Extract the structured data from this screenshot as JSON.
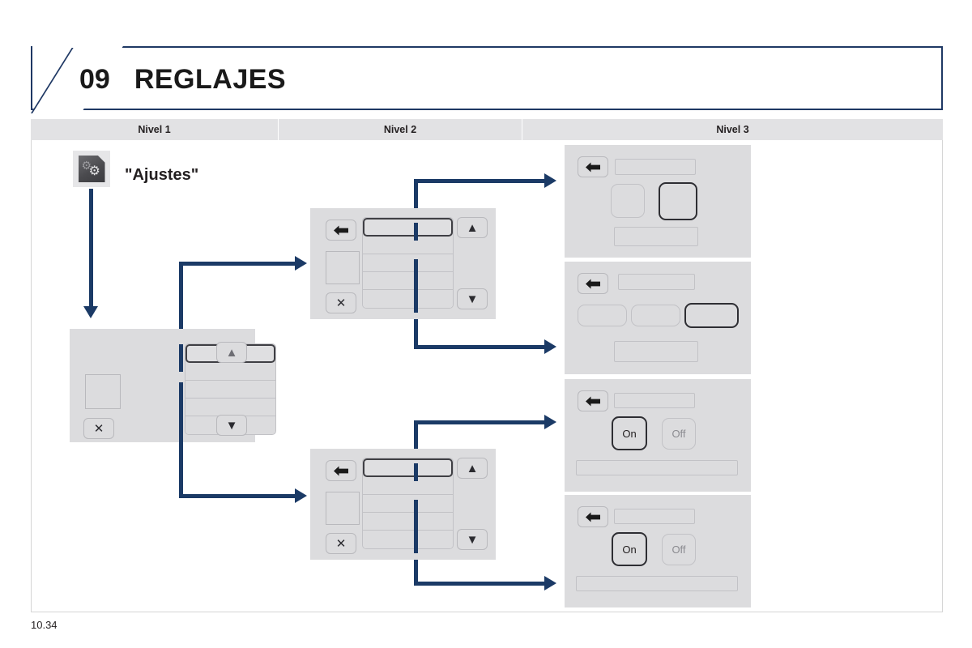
{
  "header": {
    "chapter_number": "09",
    "title": "REGLAJES",
    "border_color": "#1f3864"
  },
  "levels_bar": {
    "columns": [
      {
        "label": "Nivel 1"
      },
      {
        "label": "Nivel 2"
      },
      {
        "label": "Nivel 3"
      }
    ],
    "background": "#e2e2e4"
  },
  "app_entry": {
    "icon_name": "settings-gears-icon",
    "label": "\"Ajustes\""
  },
  "icons": {
    "back_arrow": "back-arrow-icon",
    "close": "✕",
    "up": "▲",
    "down": "▼"
  },
  "screens": {
    "level1_menu": {
      "name": "Nivel 1 menu screen",
      "close_label": "✕",
      "up_label": "▲",
      "down_label": "▼",
      "rows": [
        "",
        "",
        "",
        "",
        ""
      ],
      "selected_row_index": 0
    },
    "level2_menu_top": {
      "name": "Nivel 2 menu screen (top)",
      "back_label": "back-arrow-icon",
      "close_label": "✕",
      "up_label": "▲",
      "down_label": "▼",
      "rows": [
        "",
        "",
        "",
        "",
        ""
      ],
      "selected_row_index": 0
    },
    "level2_menu_bottom": {
      "name": "Nivel 2 menu screen (bottom)",
      "back_label": "back-arrow-icon",
      "close_label": "✕",
      "up_label": "▲",
      "down_label": "▼",
      "rows": [
        "",
        "",
        "",
        "",
        ""
      ],
      "selected_row_index": 0
    },
    "level3_two_tiles": {
      "name": "Nivel 3 screen with two option tiles",
      "back_label": "back-arrow-icon",
      "title_bar": "",
      "tiles": [
        "",
        ""
      ],
      "selected_tile_index": 1,
      "footer_bar": ""
    },
    "level3_three_tiles": {
      "name": "Nivel 3 screen with three option tiles",
      "back_label": "back-arrow-icon",
      "title_bar": "",
      "tiles": [
        "",
        "",
        ""
      ],
      "selected_tile_index": 2,
      "footer_bar": ""
    },
    "level3_onoff_a": {
      "name": "Nivel 3 On/Off screen (upper)",
      "back_label": "back-arrow-icon",
      "title_bar": "",
      "on_label": "On",
      "off_label": "Off",
      "selected": "On",
      "footer_bar": ""
    },
    "level3_onoff_b": {
      "name": "Nivel 3 On/Off screen (lower)",
      "back_label": "back-arrow-icon",
      "title_bar": "",
      "on_label": "On",
      "off_label": "Off",
      "selected": "On",
      "footer_bar": ""
    }
  },
  "connector_color": "#1b3a66",
  "footer": {
    "page_number": "10.34"
  }
}
